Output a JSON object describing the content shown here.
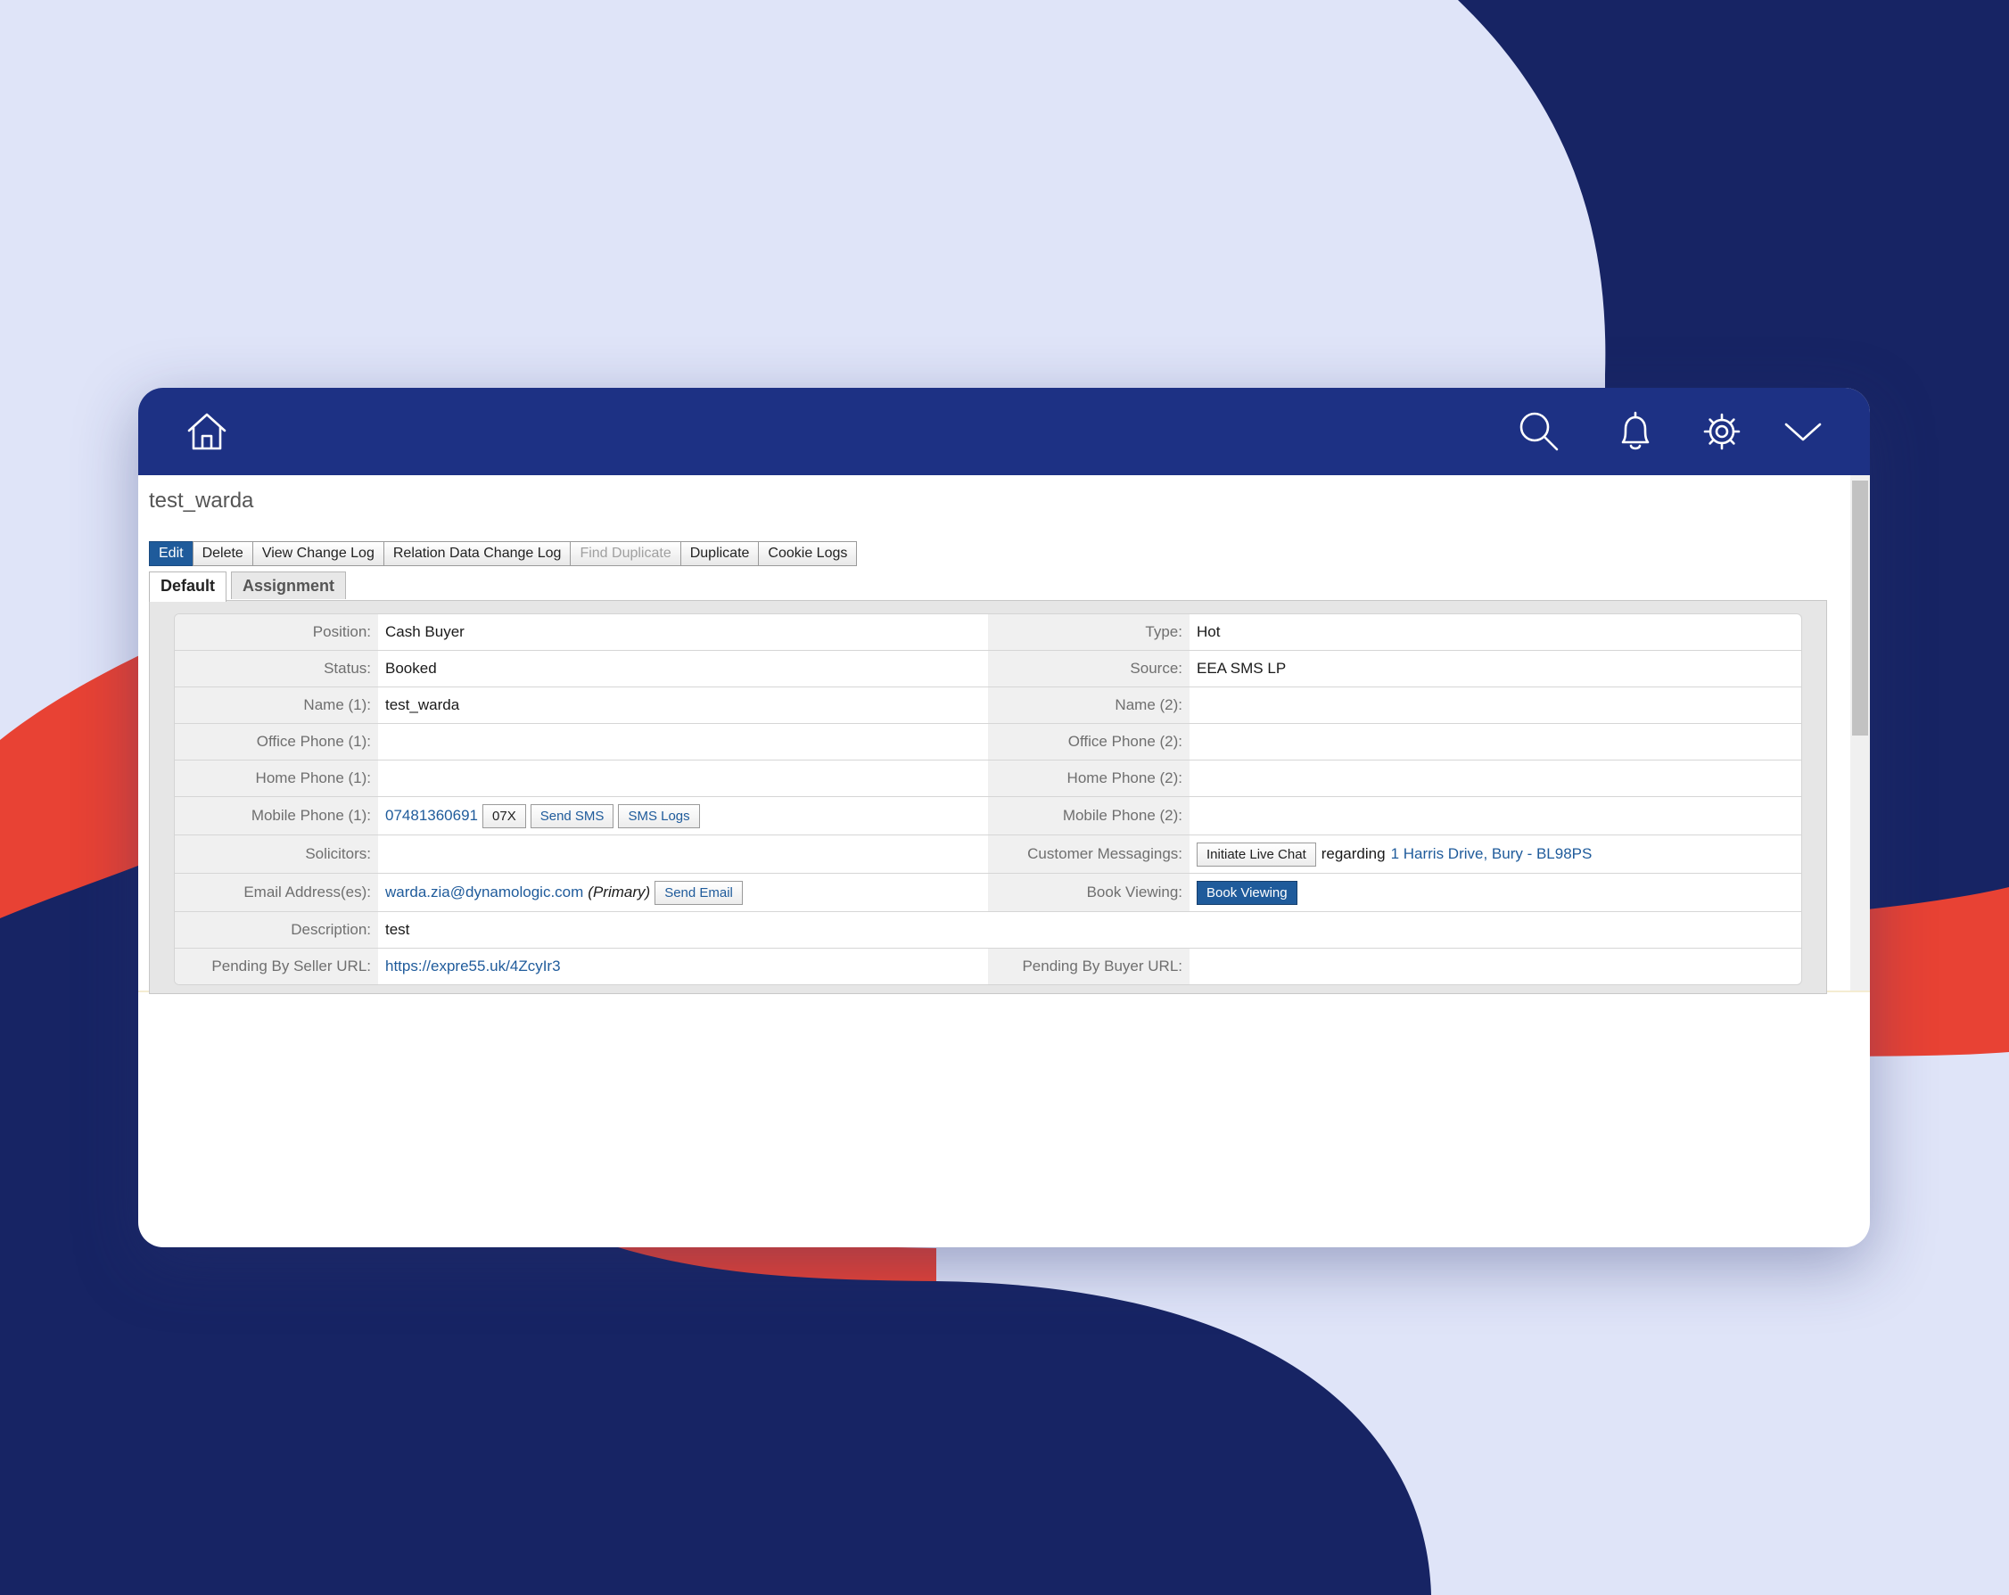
{
  "colors": {
    "page_background": "#dfe4f8",
    "background_navy": "#172464",
    "background_red": "#e84234",
    "topbar": "#1d3184",
    "primary_button": "#1f5b9b",
    "link": "#1f5b9b"
  },
  "topbar": {
    "icons": [
      "home-icon",
      "search-icon",
      "bell-icon",
      "gear-icon",
      "chevron-down-icon"
    ]
  },
  "record": {
    "title": "test_warda"
  },
  "actions": {
    "edit": "Edit",
    "delete": "Delete",
    "view_change_log": "View Change Log",
    "relation_data_change_log": "Relation Data Change Log",
    "find_duplicate": "Find Duplicate",
    "duplicate": "Duplicate",
    "cookie_logs": "Cookie Logs"
  },
  "tabs": [
    {
      "label": "Default",
      "active": true
    },
    {
      "label": "Assignment",
      "active": false
    }
  ],
  "fields": {
    "position": {
      "label": "Position:",
      "value": "Cash Buyer"
    },
    "type": {
      "label": "Type:",
      "value": "Hot"
    },
    "status": {
      "label": "Status:",
      "value": "Booked"
    },
    "source": {
      "label": "Source:",
      "value": "EEA SMS LP"
    },
    "name1": {
      "label": "Name (1):",
      "value": "test_warda"
    },
    "name2": {
      "label": "Name (2):",
      "value": ""
    },
    "office_phone1": {
      "label": "Office Phone (1):",
      "value": ""
    },
    "office_phone2": {
      "label": "Office Phone (2):",
      "value": ""
    },
    "home_phone1": {
      "label": "Home Phone (1):",
      "value": ""
    },
    "home_phone2": {
      "label": "Home Phone (2):",
      "value": ""
    },
    "mobile_phone1": {
      "label": "Mobile Phone (1):",
      "value": "07481360691",
      "prefix_button": "07X",
      "send_sms": "Send SMS",
      "sms_logs": "SMS Logs"
    },
    "mobile_phone2": {
      "label": "Mobile Phone (2):",
      "value": ""
    },
    "solicitors": {
      "label": "Solicitors:",
      "value": ""
    },
    "customer_messaging": {
      "label": "Customer Messagings:",
      "button": "Initiate Live Chat",
      "regarding": "regarding",
      "property_link": "1 Harris Drive, Bury - BL98PS"
    },
    "email": {
      "label": "Email Address(es):",
      "value": "warda.zia@dynamologic.com",
      "tag": "(Primary)",
      "send_email": "Send Email"
    },
    "book_viewing": {
      "label": "Book Viewing:",
      "button": "Book Viewing"
    },
    "description": {
      "label": "Description:",
      "value": "test"
    },
    "pending_seller_url": {
      "label": "Pending By Seller URL:",
      "value": "https://expre55.uk/4ZcyIr3"
    },
    "pending_buyer_url": {
      "label": "Pending By Buyer URL:",
      "value": ""
    }
  }
}
